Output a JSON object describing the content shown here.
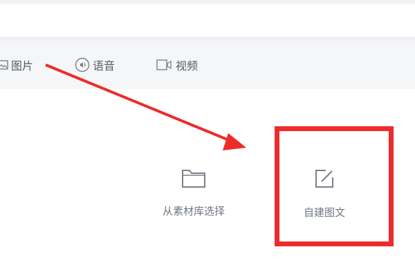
{
  "tabs": [
    {
      "label": "图片",
      "icon": "image-icon"
    },
    {
      "label": "语音",
      "icon": "audio-icon"
    },
    {
      "label": "视频",
      "icon": "video-icon"
    }
  ],
  "options": [
    {
      "label": "从素材库选择",
      "icon": "folder-icon"
    },
    {
      "label": "自建图文",
      "icon": "edit-icon"
    }
  ],
  "annotation": {
    "highlight_color": "#ee2b2b",
    "arrow_color": "#ee2b2b"
  },
  "colors": {
    "tab_bar_bg": "#f5f6f8",
    "icon_gray": "#7a8089",
    "text_gray": "#555b63"
  }
}
